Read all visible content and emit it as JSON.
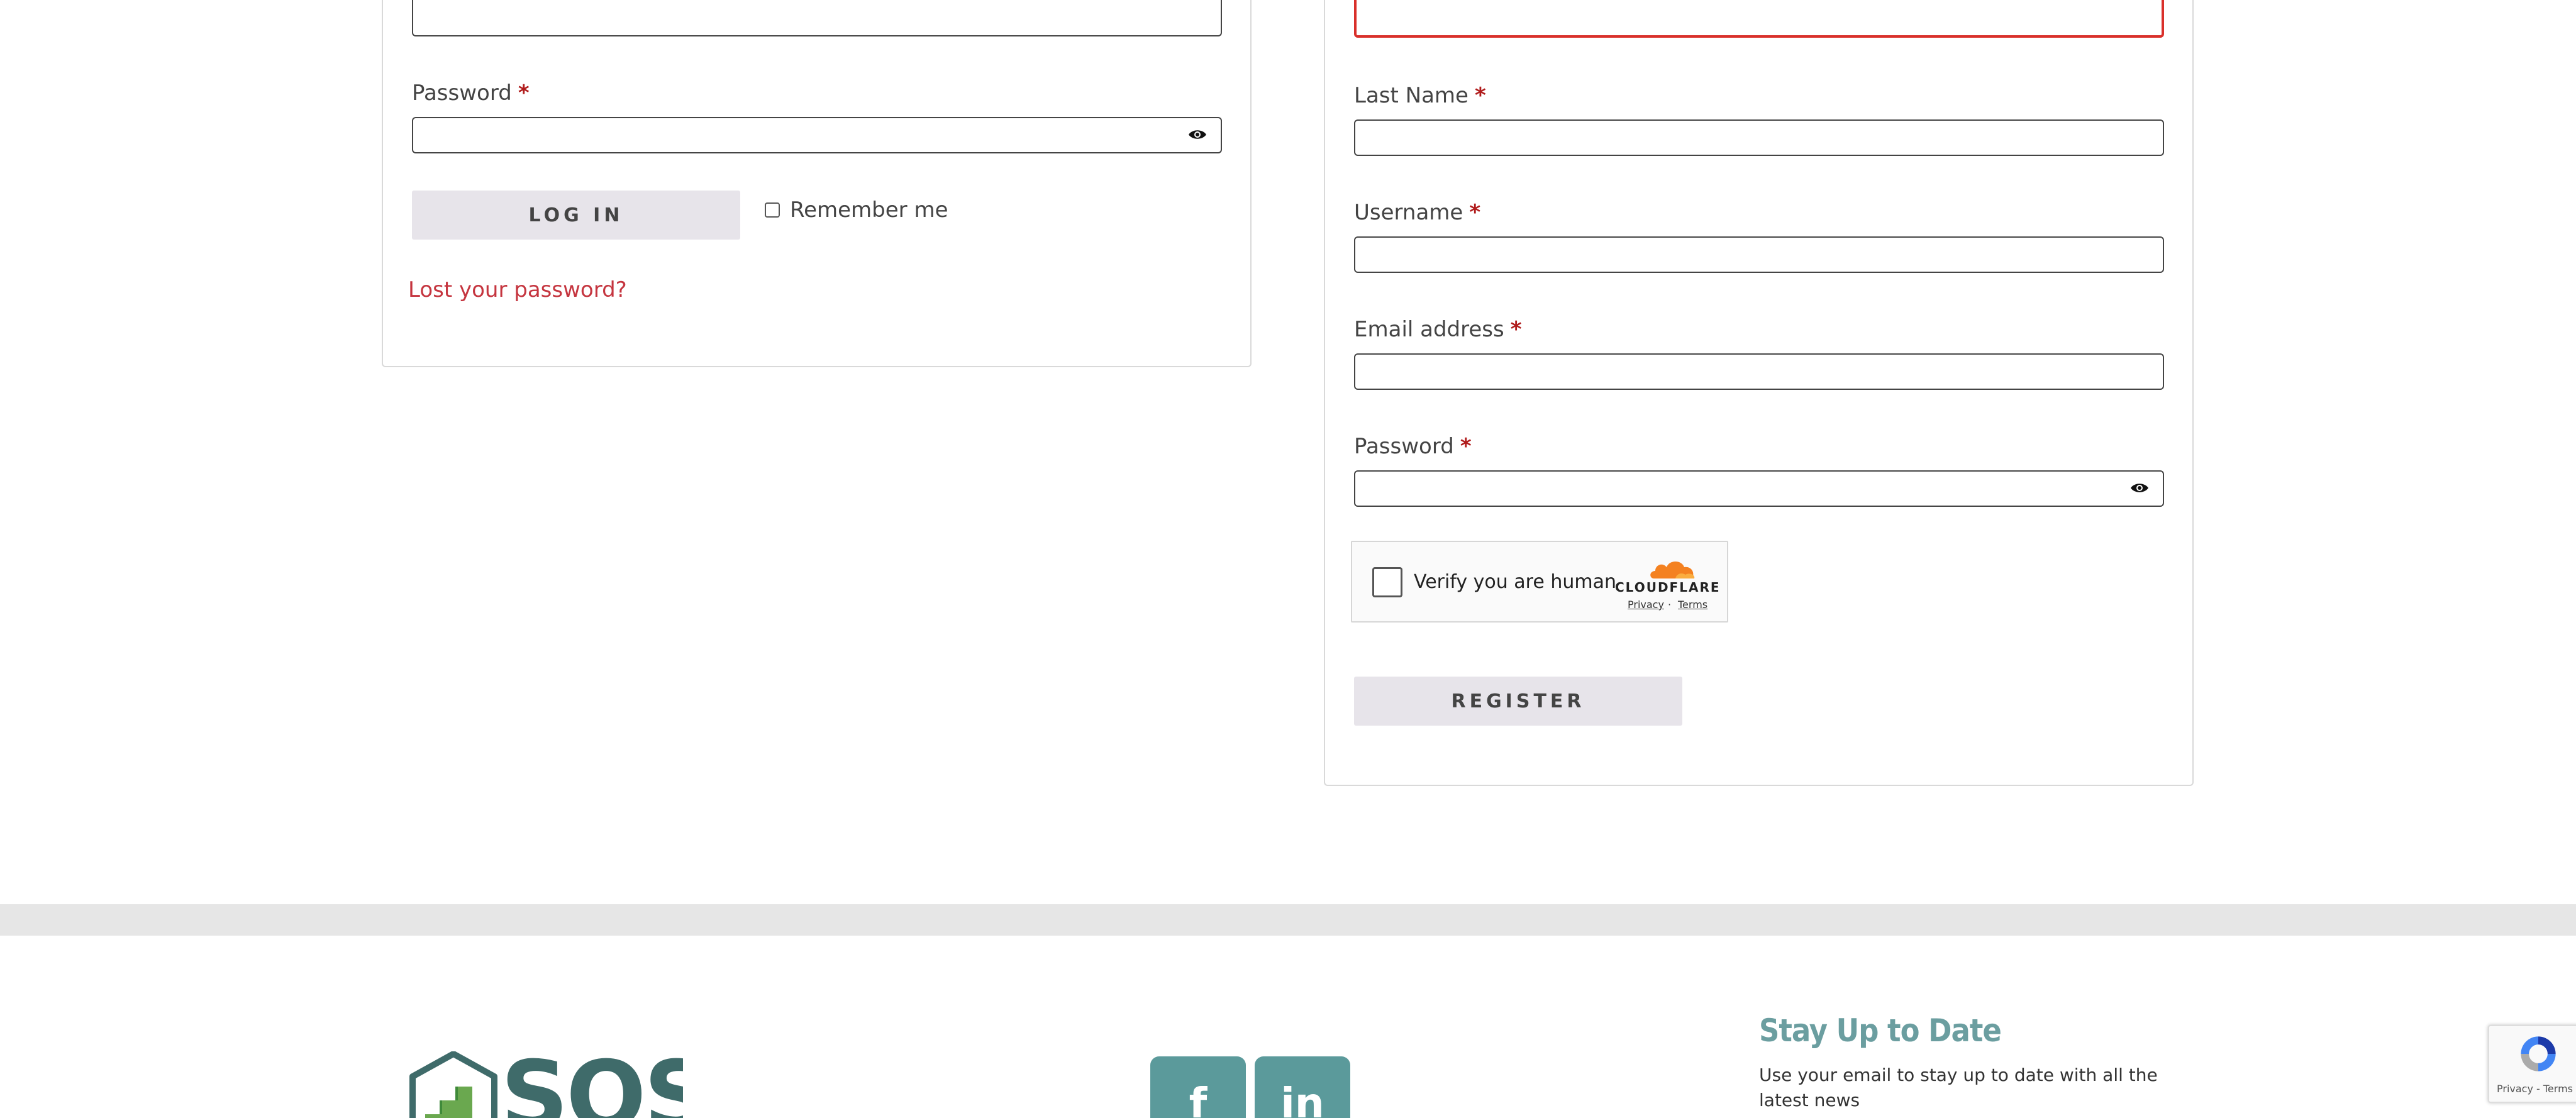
{
  "login": {
    "password_label": "Password",
    "required_mark": "*",
    "login_button": "LOG IN",
    "remember_label": "Remember me",
    "lost_password": "Lost your password?"
  },
  "register": {
    "last_name_label": "Last Name",
    "username_label": "Username",
    "email_label": "Email address",
    "password_label": "Password",
    "required_mark": "*",
    "register_button": "REGISTER"
  },
  "captcha": {
    "label": "Verify you are human",
    "brand": "CLOUDFLARE",
    "privacy": "Privacy",
    "separator": "·",
    "terms": "Terms"
  },
  "footer": {
    "logo_text": "SOS",
    "facebook_glyph": "f",
    "linkedin_glyph": "in",
    "newsletter_title": "Stay Up to Date",
    "newsletter_text": "Use your email to stay up to date with all the latest news",
    "recaptcha_links": "Privacy - Terms"
  },
  "colors": {
    "accent_link": "#c5353f",
    "required": "#b01b1b",
    "error_border": "#d9302b",
    "footer_teal": "#5b9a9b",
    "footer_title": "#6b9ea0"
  }
}
